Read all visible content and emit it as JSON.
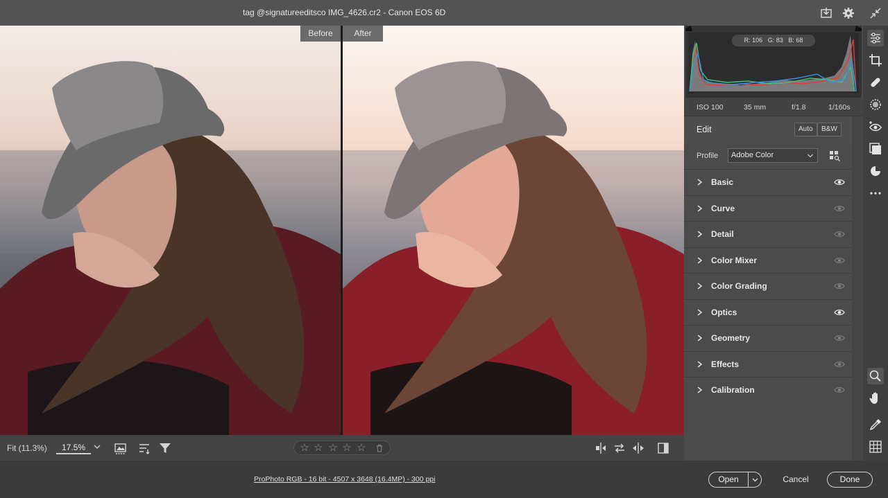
{
  "titlebar": {
    "title": "tag @signatureeditsco IMG_4626.cr2  -  Canon EOS 6D",
    "icons": [
      "save-download-icon",
      "settings-gear-icon",
      "collapse-icon"
    ]
  },
  "compare": {
    "before_label": "Before",
    "after_label": "After"
  },
  "viewbar": {
    "fit_label": "Fit (11.3%)",
    "zoom_value": "17.5%",
    "icons": [
      "image-view-icon",
      "sort-icon",
      "filter-icon",
      "swap-before-after-icon",
      "copy-settings-icon",
      "swap-icon",
      "toggle-split-icon"
    ],
    "rating": {
      "stars": 5,
      "filled": 0
    }
  },
  "statusbar": {
    "file_info": "ProPhoto RGB - 16 bit - 4507 x 3648 (16.4MP) - 300 ppi",
    "open_label": "Open",
    "cancel_label": "Cancel",
    "done_label": "Done"
  },
  "histogram": {
    "r_label": "R:",
    "r_value": "106",
    "g_label": "G:",
    "g_value": "83",
    "b_label": "B:",
    "b_value": "68"
  },
  "exif": {
    "iso": "ISO 100",
    "focal": "35 mm",
    "aperture": "f/1.8",
    "shutter": "1/160s"
  },
  "edit": {
    "title": "Edit",
    "auto_label": "Auto",
    "bw_label": "B&W",
    "profile_label": "Profile",
    "profile_value": "Adobe Color"
  },
  "sections": [
    {
      "label": "Basic",
      "eye": "bright"
    },
    {
      "label": "Curve",
      "eye": "dim"
    },
    {
      "label": "Detail",
      "eye": "dim"
    },
    {
      "label": "Color Mixer",
      "eye": "dim"
    },
    {
      "label": "Color Grading",
      "eye": "dim"
    },
    {
      "label": "Optics",
      "eye": "bright"
    },
    {
      "label": "Geometry",
      "eye": "dim"
    },
    {
      "label": "Effects",
      "eye": "dim"
    },
    {
      "label": "Calibration",
      "eye": "dim"
    }
  ],
  "tools": [
    "edit-sliders-icon",
    "crop-icon",
    "healing-icon",
    "masking-icon",
    "red-eye-icon",
    "presets-icon",
    "snapshots-icon",
    "more-icon",
    "zoom-icon",
    "hand-icon",
    "eyedropper-icon",
    "grid-icon"
  ],
  "colors": {
    "panel": "#4b4b4b",
    "titlebar": "#535353",
    "accent_red": "#e03a3a",
    "accent_green": "#3ec47a",
    "accent_blue": "#3a8ee0"
  }
}
